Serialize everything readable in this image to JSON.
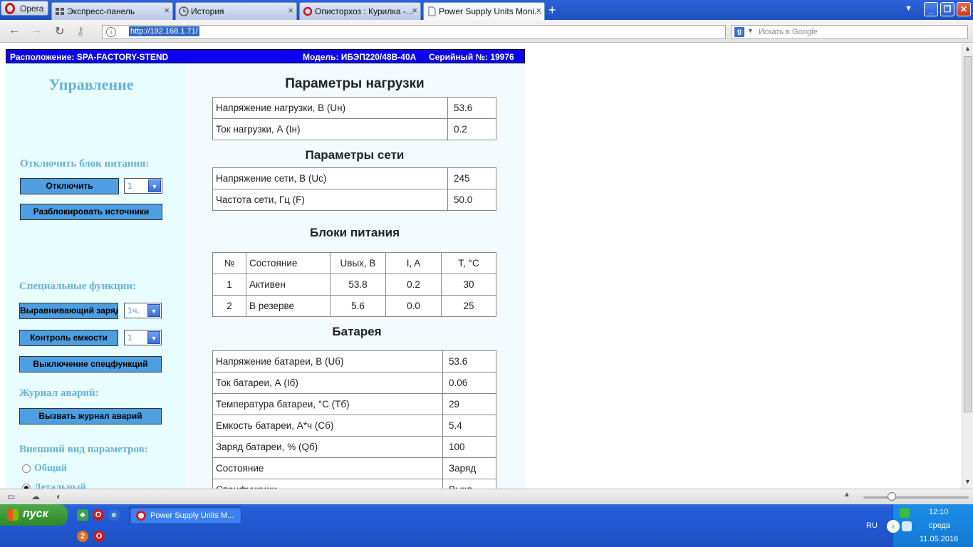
{
  "browser": {
    "menu_label": "Opera",
    "tabs": [
      {
        "label": "Экспресс-панель",
        "icon": "grid-icon"
      },
      {
        "label": "История",
        "icon": "clock-icon"
      },
      {
        "label": "Описторхоз : Курилка -...",
        "icon": "site-icon"
      },
      {
        "label": "Power Supply Units Moni...",
        "icon": "page-icon",
        "active": true
      }
    ],
    "new_tab": "+",
    "close_glyph": "×",
    "url": "http://192.168.1.71/",
    "search_placeholder": "Искать в Google"
  },
  "header": {
    "location": "Расположение: SPA-FACTORY-STEND",
    "model": "Модель: ИБЭП220/48В-40А",
    "serial": "Серийный №:  19976",
    "bg_color": "#0c00ee"
  },
  "control": {
    "title": "Управление",
    "disable_label": "Отключить блок питания:",
    "disable_button": "Отключить",
    "disable_select": "1",
    "unlock_button": "Разблокировать источники",
    "special_label": "Специальные функции:",
    "equalize_button": "Выравнивающий заряд",
    "equalize_select": "1ч.",
    "capacity_button": "Контроль емкости",
    "capacity_select": "1",
    "special_off_button": "Выключение спецфункций",
    "alarm_label": "Журнал аварий:",
    "alarm_button": "Вызвать журнал аварий",
    "view_label": "Внешний вид параметров:",
    "view_general": "Общий",
    "view_detailed": "Детальный",
    "button_color": "#4d9fe2",
    "label_color": "#67b1d7"
  },
  "load": {
    "title": "Параметры нагрузки",
    "rows": [
      {
        "label": "Напряжение нагрузки, В (Uн)",
        "value": "53.6"
      },
      {
        "label": "Ток нагрузки, А (Iн)",
        "value": "0.2"
      }
    ]
  },
  "mains": {
    "title": "Параметры сети",
    "rows": [
      {
        "label": "Напряжение сети, В (Uс)",
        "value": "245"
      },
      {
        "label": "Частота сети, Гц (F)",
        "value": "50.0"
      }
    ]
  },
  "psu": {
    "title": "Блоки питания",
    "headers": [
      "№",
      "Состояние",
      "Uвых, В",
      "I, A",
      "T, °C"
    ],
    "rows": [
      [
        "1",
        "Активен",
        "53.8",
        "0.2",
        "30"
      ],
      [
        "2",
        "В резерве",
        "5.6",
        "0.0",
        "25"
      ]
    ]
  },
  "battery": {
    "title": "Батарея",
    "rows": [
      {
        "label": "Напряжение батареи, В (Uб)",
        "value": "53.6"
      },
      {
        "label": "Ток батареи, А (Iб)",
        "value": "0.06"
      },
      {
        "label": "Температура батареи, °C (Tб)",
        "value": "29"
      },
      {
        "label": "Емкость батареи, А*ч (Cб)",
        "value": "5.4"
      },
      {
        "label": "Заряд батареи, % (Qб)",
        "value": "100"
      },
      {
        "label": "Состояние",
        "value": "Заряд"
      },
      {
        "label": "Спецфункции",
        "value": "Выкл."
      }
    ]
  },
  "taskbar": {
    "start_label": "пуск",
    "task_label": "Power Supply Units M...",
    "quick_badge": "2",
    "lang": "RU",
    "time": "12:10",
    "day": "среда",
    "date": "11.05.2016"
  }
}
